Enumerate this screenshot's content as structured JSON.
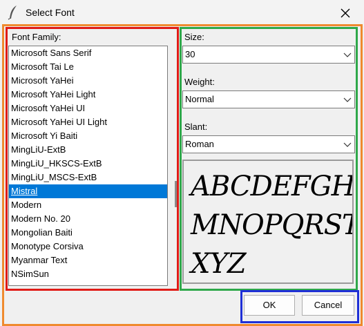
{
  "window": {
    "title": "Select Font",
    "icon": "feather-icon",
    "close_icon": "close-icon"
  },
  "font_family": {
    "label": "Font Family:",
    "items": [
      "Microsoft Sans Serif",
      "Microsoft Tai Le",
      "Microsoft YaHei",
      "Microsoft YaHei Light",
      "Microsoft YaHei UI",
      "Microsoft YaHei UI Light",
      "Microsoft Yi Baiti",
      "MingLiU-ExtB",
      "MingLiU_HKSCS-ExtB",
      "MingLiU_MSCS-ExtB",
      "Mistral",
      "Modern",
      "Modern No. 20",
      "Mongolian Baiti",
      "Monotype Corsiva",
      "Myanmar Text",
      "NSimSun"
    ],
    "selected": "Mistral"
  },
  "size": {
    "label": "Size:",
    "value": "30"
  },
  "weight": {
    "label": "Weight:",
    "value": "Normal"
  },
  "slant": {
    "label": "Slant:",
    "value": "Roman"
  },
  "preview": {
    "lines": [
      "ABCDEFGHIJK",
      "MNOPQRSTUVW",
      "XYZ"
    ]
  },
  "buttons": {
    "ok": "OK",
    "cancel": "Cancel"
  },
  "colors": {
    "red_frame": "#e01b16",
    "green_frame": "#2ea84a",
    "orange_frame": "#ef8a2e",
    "blue_frame": "#1f2fd6",
    "selection": "#0078d7"
  }
}
